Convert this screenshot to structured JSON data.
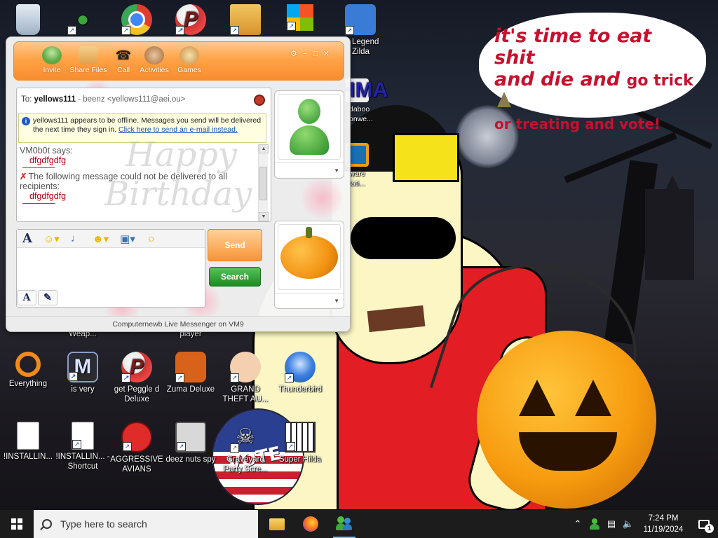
{
  "wallpaper": {
    "speech_line1": "it's time to eat shit",
    "speech_line2_big": "and die and",
    "speech_line2_small": "go trick",
    "speech_line3": "or treating and vote!",
    "badge_text": "VOTE",
    "badge_colors": [
      "#c8202e",
      "#ffffff",
      "#2a3f8f"
    ]
  },
  "desktop_icons": {
    "col1": [
      {
        "label": "",
        "icon": "recycle-bin-icon"
      },
      {
        "label": "Everything",
        "icon": "everything-search-icon"
      },
      {
        "label": "!INSTALLIN...",
        "icon": "text-document-icon"
      }
    ],
    "col2": [
      {
        "label": "",
        "icon": "msn-messenger-icon"
      },
      {
        "label": "is very",
        "icon": "m-shield-icon"
      },
      {
        "label": "!INSTALLIN... - Shortcut",
        "icon": "text-document-shortcut-icon"
      }
    ],
    "col3": [
      {
        "label": "",
        "icon": "chrome-icon"
      },
      {
        "label": "get Peggle d Deluxe",
        "icon": "peggle-icon"
      },
      {
        "label": "AGGRESSIVE AVIANS",
        "icon": "angry-bird-icon"
      }
    ],
    "col4": [
      {
        "label": "",
        "icon": "peggle-small-icon"
      },
      {
        "label": "Zuma Deluxe",
        "icon": "zuma-icon"
      },
      {
        "label": "deez nuts spy",
        "icon": "stacked-windows-icon"
      }
    ],
    "col5": [
      {
        "label": "",
        "icon": "folder-icon"
      },
      {
        "label": "GRAND THEFT AU...",
        "icon": "anime-girl-icon"
      },
      {
        "label": "Graveyard Party Scre...",
        "icon": "graveyard-icon"
      }
    ],
    "col6": [
      {
        "label": "",
        "icon": "windows-logo-icon"
      },
      {
        "label": "Thunderbird",
        "icon": "thunderbird-icon"
      },
      {
        "label": "Super Hilda",
        "icon": "pixel-game-icon"
      }
    ],
    "col7": [
      {
        "label": "Legend Zilda",
        "icon": "zelda-icon"
      },
      {
        "label": "daboo onwe...",
        "icon": "shma-icon"
      },
      {
        "label": "ware tati...",
        "icon": "vmware-icon"
      }
    ],
    "partial_labels": {
      "weap": "Weap...",
      "player": "player"
    }
  },
  "messenger": {
    "toolbar": {
      "invite": "Invite",
      "share_files": "Share Files",
      "call": "Call",
      "activities": "Activities",
      "games": "Games"
    },
    "to_label": "To:",
    "contact_name": "yellows111",
    "contact_meta": "- beenz <yellows111@aei.ou>",
    "offline_text": "yellows111 appears to be offline. Messages you send will be delivered the next time they sign in.",
    "offline_link": "Click here to send an e-mail instead.",
    "conversation": {
      "sender": "VM0b0t says:",
      "message1": "dfgdfgdfg",
      "fail_notice": "The following message could not be delivered to all recipients:",
      "message2": "dfgdfgdfg"
    },
    "watermark_line1": "Happy",
    "watermark_line2": "Birthday",
    "send_label": "Send",
    "search_label": "Search",
    "status_bar": "Computernewb Live Messenger on VM9",
    "accent": "#f79437"
  },
  "taskbar": {
    "search_placeholder": "Type here to search",
    "time": "7:24 PM",
    "date": "11/19/2024",
    "notification_count": "1"
  }
}
